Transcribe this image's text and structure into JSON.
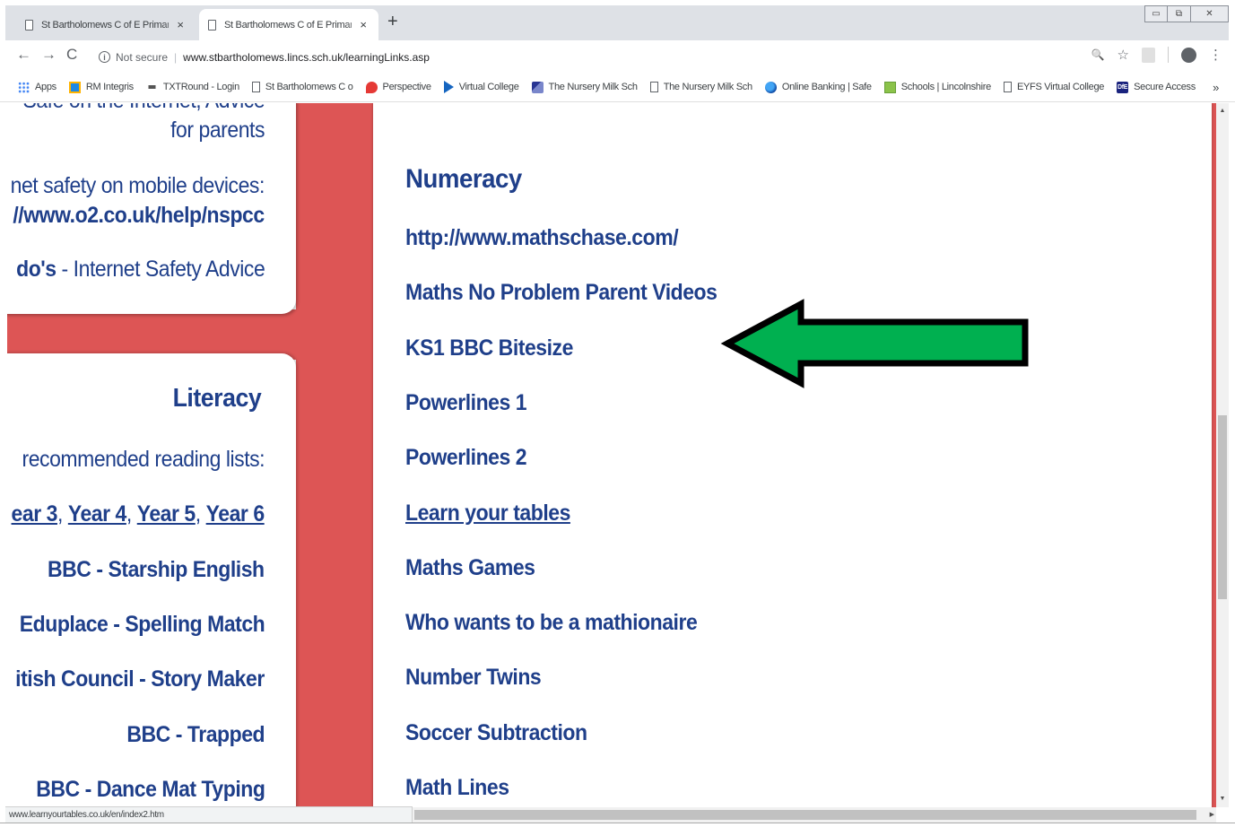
{
  "browser": {
    "tabs": [
      {
        "title": "St Bartholomews C of E Primary S",
        "close": "×"
      },
      {
        "title": "St Bartholomews C of E Primary S",
        "close": "×"
      }
    ],
    "new_tab": "+",
    "window_controls": {
      "minimize": "▭",
      "maximize": "⧉",
      "close": "✕"
    },
    "nav": {
      "back": "←",
      "forward": "→",
      "reload": "C"
    },
    "address": {
      "security_label": "Not secure",
      "url": "www.stbartholomews.lincs.sch.uk/learningLinks.asp"
    },
    "toolbar_icons": {
      "zoom": "🔍",
      "star": "☆",
      "menu": "⋮",
      "profile": "●"
    },
    "bookmarks": [
      {
        "label": "Apps",
        "icon": "apps-icon"
      },
      {
        "label": "RM Integris",
        "icon": "rm-icon"
      },
      {
        "label": "TXTRound - Login",
        "icon": "txtround-icon"
      },
      {
        "label": "St Bartholomews C o",
        "icon": "page-icon"
      },
      {
        "label": "Perspective",
        "icon": "perspective-icon"
      },
      {
        "label": "Virtual College",
        "icon": "play-icon"
      },
      {
        "label": "The Nursery Milk Sch",
        "icon": "nursery-icon"
      },
      {
        "label": "The Nursery Milk Sch",
        "icon": "page-icon"
      },
      {
        "label": "Online Banking | Safe",
        "icon": "bank-icon"
      },
      {
        "label": "Schools | Lincolnshire",
        "icon": "schools-icon"
      },
      {
        "label": "EYFS Virtual College",
        "icon": "page-icon"
      },
      {
        "label": "Secure Access",
        "icon": "dfe-icon",
        "icon_text": "DfE"
      }
    ],
    "bookmarks_more": "»",
    "status_url": "www.learnyourtables.co.uk/en/index2.htm"
  },
  "left_column": {
    "top_card": {
      "line1": "Safe on the Internet, Advice",
      "line2": "for parents",
      "line3": "net safety on mobile devices:",
      "line4": "//www.o2.co.uk/help/nspcc",
      "line5_bold": "do's",
      "line5_rest": " - Internet Safety Advice"
    },
    "literacy": {
      "heading": "Literacy",
      "reading_lists": "recommended reading lists:",
      "years": [
        "ear 3",
        "Year 4",
        "Year 5",
        "Year 6"
      ],
      "year_sep": ", ",
      "links": [
        "BBC - Starship English",
        "Eduplace - Spelling Match",
        "itish Council - Story Maker",
        "BBC - Trapped",
        "BBC - Dance Mat Typing"
      ]
    }
  },
  "numeracy": {
    "heading": "Numeracy",
    "links": [
      {
        "label": "http://www.mathschase.com/",
        "underline": false
      },
      {
        "label": "Maths No Problem Parent Videos",
        "underline": false
      },
      {
        "label": "KS1 BBC Bitesize",
        "underline": false
      },
      {
        "label": "Powerlines 1",
        "underline": false
      },
      {
        "label": "Powerlines 2",
        "underline": false
      },
      {
        "label": "Learn your tables",
        "underline": true
      },
      {
        "label": "Maths Games",
        "underline": false
      },
      {
        "label": "Who wants to be a mathionaire",
        "underline": false
      },
      {
        "label": "Number Twins",
        "underline": false
      },
      {
        "label": "Soccer Subtraction",
        "underline": false
      },
      {
        "label": "Math Lines",
        "underline": false
      }
    ]
  },
  "annotation": {
    "arrow_fill": "#00b050",
    "arrow_stroke": "#000000",
    "points_to": "http://www.mathschase.com/"
  },
  "colors": {
    "link": "#1f3f8a",
    "band": "#dd5555"
  }
}
